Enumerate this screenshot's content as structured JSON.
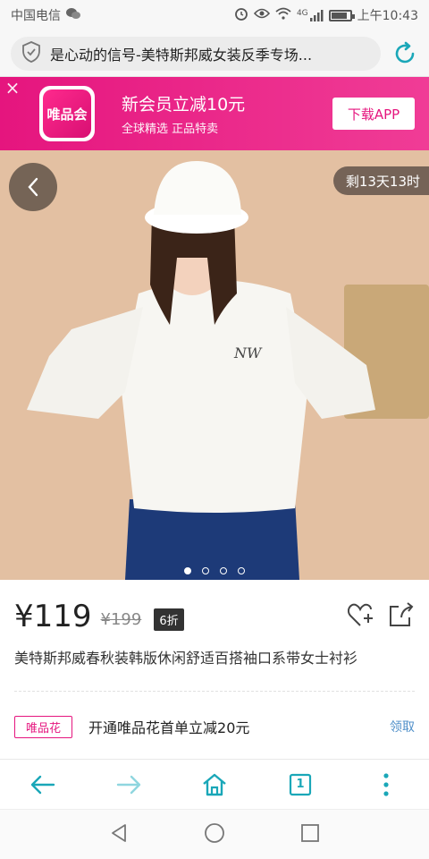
{
  "status_bar": {
    "carrier": "中国电信",
    "time": "上午10:43",
    "network": "4G",
    "battery_level": 0.85
  },
  "address_bar": {
    "url_title": "是心动的信号-美特斯邦威女装反季专场..."
  },
  "promo_banner": {
    "logo_text": "唯品会",
    "title": "新会员立减10元",
    "subtitle": "全球精选 正品特卖",
    "download_label": "下载APP"
  },
  "product_image": {
    "countdown": "剩13天13时",
    "carousel_count": 4,
    "carousel_active": 0
  },
  "product": {
    "price": "¥119",
    "original_price": "¥199",
    "discount": "6折",
    "title": "美特斯邦威春秋装韩版休闲舒适百搭袖口系带女士衬衫"
  },
  "promotion": {
    "tag": "唯品花",
    "text": "开通唯品花首单立减20元",
    "claim_label": "领取"
  },
  "browser_nav": {
    "tab_count": "1"
  },
  "colors": {
    "brand_pink": "#e5157e",
    "accent_teal": "#1aa7b8",
    "link_blue": "#4f8fc9"
  }
}
